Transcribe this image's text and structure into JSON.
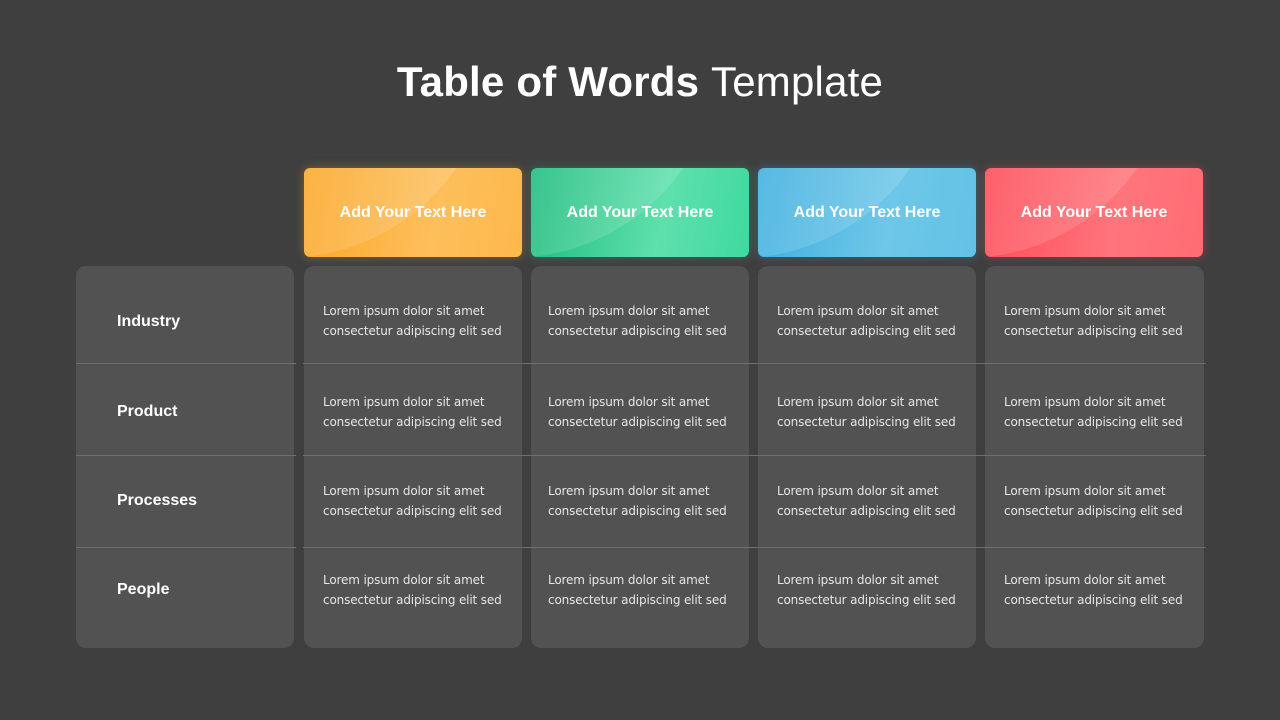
{
  "title": {
    "bold": "Table of Words",
    "light": "Template"
  },
  "columns": [
    {
      "label": "Add Your  Text Here",
      "color": "#fba726"
    },
    {
      "label": "Add Your  Text Here",
      "color": "#1cbc7c"
    },
    {
      "label": "Add Your  Text Here",
      "color": "#3eafdf"
    },
    {
      "label": "Add Your  Text Here",
      "color": "#fd4a55"
    }
  ],
  "rows": [
    {
      "label": "Industry",
      "cells": [
        {
          "line1": "Lorem ipsum dolor sit amet",
          "line2": "consectetur adipiscing elit sed"
        },
        {
          "line1": "Lorem ipsum dolor sit amet",
          "line2": "consectetur adipiscing elit sed"
        },
        {
          "line1": "Lorem ipsum dolor sit amet",
          "line2": "consectetur adipiscing elit sed"
        },
        {
          "line1": "Lorem ipsum dolor sit amet",
          "line2": "consectetur adipiscing elit sed"
        }
      ]
    },
    {
      "label": "Product",
      "cells": [
        {
          "line1": "Lorem ipsum dolor sit amet",
          "line2": "consectetur adipiscing elit sed"
        },
        {
          "line1": "Lorem ipsum dolor sit amet",
          "line2": "consectetur adipiscing elit sed"
        },
        {
          "line1": "Lorem ipsum dolor sit amet",
          "line2": "consectetur adipiscing elit sed"
        },
        {
          "line1": "Lorem ipsum dolor sit amet",
          "line2": "consectetur adipiscing elit sed"
        }
      ]
    },
    {
      "label": "Processes",
      "cells": [
        {
          "line1": "Lorem ipsum dolor sit amet",
          "line2": "consectetur adipiscing elit sed"
        },
        {
          "line1": "Lorem ipsum dolor sit amet",
          "line2": "consectetur adipiscing elit sed"
        },
        {
          "line1": "Lorem ipsum dolor sit amet",
          "line2": "consectetur adipiscing elit sed"
        },
        {
          "line1": "Lorem ipsum dolor sit amet",
          "line2": "consectetur adipiscing elit sed"
        }
      ]
    },
    {
      "label": "People",
      "cells": [
        {
          "line1": "Lorem ipsum dolor sit amet",
          "line2": "consectetur adipiscing elit sed"
        },
        {
          "line1": "Lorem ipsum dolor sit amet",
          "line2": "consectetur adipiscing elit sed"
        },
        {
          "line1": "Lorem ipsum dolor sit amet",
          "line2": "consectetur adipiscing elit sed"
        },
        {
          "line1": "Lorem ipsum dolor sit amet",
          "line2": "consectetur adipiscing elit sed"
        }
      ]
    }
  ]
}
